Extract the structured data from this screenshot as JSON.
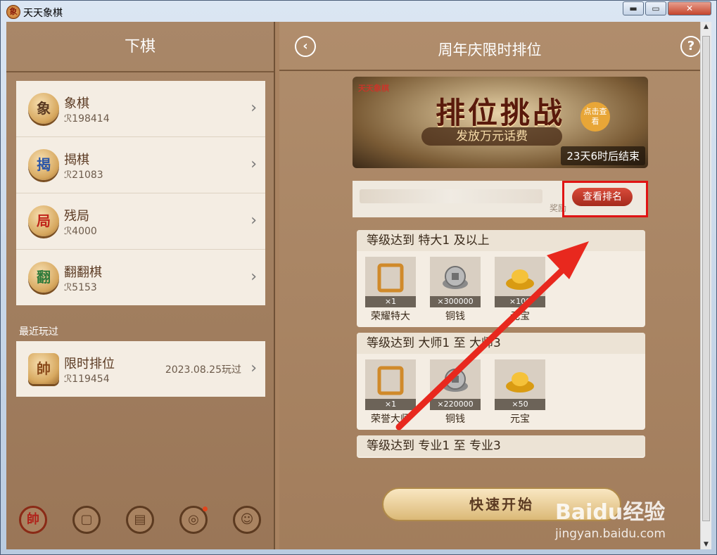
{
  "window": {
    "title": "天天象棋",
    "min": "▬",
    "max": "▭",
    "close": "✕"
  },
  "left": {
    "header": "下棋",
    "games": [
      {
        "name": "象棋",
        "count": "198414",
        "glyph": "象",
        "color": "#5b3a22"
      },
      {
        "name": "揭棋",
        "count": "21083",
        "glyph": "揭",
        "color": "#2b56a8"
      },
      {
        "name": "残局",
        "count": "4000",
        "glyph": "局",
        "color": "#c0241a"
      },
      {
        "name": "翻翻棋",
        "count": "5153",
        "glyph": "翻",
        "color": "#2e7a3a"
      }
    ],
    "recent_label": "最近玩过",
    "recent": {
      "name": "限时排位",
      "count": "119454",
      "date": "2023.08.25玩过",
      "glyph": "帥"
    },
    "nav": [
      "帥",
      "▢",
      "▤",
      "◎",
      "☺"
    ]
  },
  "right": {
    "header": "周年庆限时排位",
    "back": "‹",
    "help": "?",
    "banner": {
      "logo": "天天象棋",
      "title": "排位挑战",
      "subtitle": "发放万元话费",
      "click": "点击查看",
      "end": "23天6时后结束"
    },
    "info": {
      "prize": "奖励",
      "rank_button": "查看排名"
    },
    "tiers": [
      {
        "title": "等级达到 特大1 及以上",
        "rewards": [
          {
            "name": "荣耀特大",
            "qty": "×1",
            "kind": "frame"
          },
          {
            "name": "铜钱",
            "qty": "×300000",
            "kind": "coin"
          },
          {
            "name": "元宝",
            "qty": "×100",
            "kind": "gold"
          }
        ]
      },
      {
        "title": "等级达到 大师1 至 大师3",
        "rewards": [
          {
            "name": "荣誉大师",
            "qty": "×1",
            "kind": "frame"
          },
          {
            "name": "铜钱",
            "qty": "×220000",
            "kind": "coin"
          },
          {
            "name": "元宝",
            "qty": "×50",
            "kind": "gold"
          }
        ]
      },
      {
        "title": "等级达到 专业1 至 专业3",
        "rewards": []
      }
    ],
    "quick_start": "快速开始"
  },
  "watermark": {
    "main": "Baidu经验",
    "sub": "jingyan.baidu.com"
  }
}
